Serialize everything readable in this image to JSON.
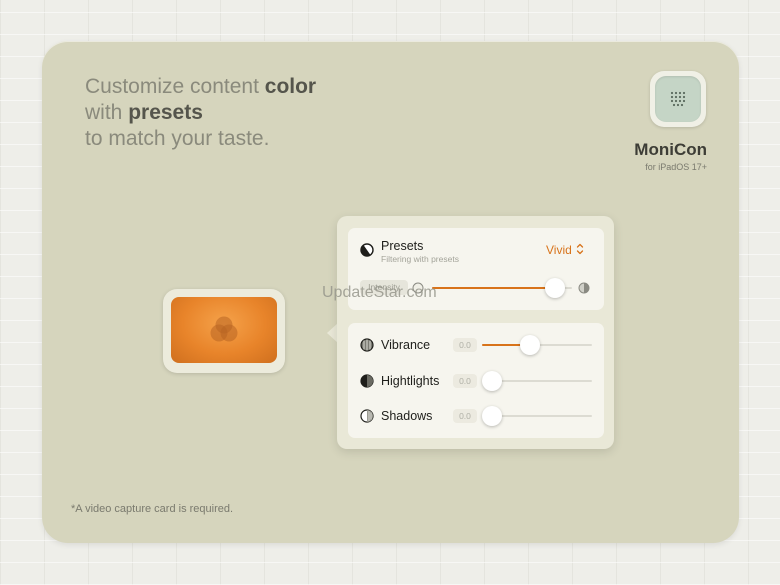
{
  "headline": {
    "line1_pre": "Customize content ",
    "line1_bold": "color",
    "line2_pre": "with ",
    "line2_bold": "presets",
    "line3": "to match your taste."
  },
  "app": {
    "name": "MoniCon",
    "subtitle": "for iPadOS 17+",
    "icon": "monitor-grid-icon"
  },
  "presets": {
    "icon": "half-circle-icon",
    "label": "Presets",
    "sublabel": "Filtering with presets",
    "selected": "Vivid",
    "intensity_label": "Intensity",
    "intensity_value": 0.88
  },
  "adjustments": [
    {
      "label": "Vibrance",
      "value_text": "0.0",
      "level": 0.44,
      "icon": "striped-circle-icon"
    },
    {
      "label": "Hightlights",
      "value_text": "0.0",
      "level": 0.0,
      "icon": "half-filled-circle-icon"
    },
    {
      "label": "Shadows",
      "value_text": "0.0",
      "level": 0.0,
      "icon": "half-striped-circle-icon"
    }
  ],
  "colors": {
    "accent": "#d8731a",
    "card": "#d6d5bd",
    "preview": "#e8842a"
  },
  "watermark": "UpdateStar.com",
  "footnote": "*A video capture card is required."
}
